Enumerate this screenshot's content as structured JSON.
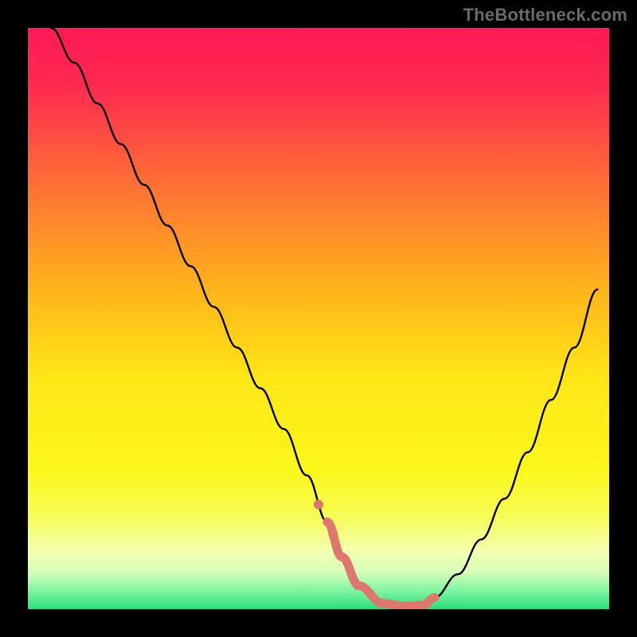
{
  "watermark": "TheBottleneck.com",
  "gradient_stops": [
    {
      "offset": 0.0,
      "color": "#ff1a55"
    },
    {
      "offset": 0.1,
      "color": "#ff2a50"
    },
    {
      "offset": 0.25,
      "color": "#ff6838"
    },
    {
      "offset": 0.45,
      "color": "#ffb41a"
    },
    {
      "offset": 0.6,
      "color": "#ffe617"
    },
    {
      "offset": 0.76,
      "color": "#fbf71a"
    },
    {
      "offset": 0.84,
      "color": "#f6fd55"
    },
    {
      "offset": 0.9,
      "color": "#f4ffb0"
    },
    {
      "offset": 0.935,
      "color": "#d9ffb8"
    },
    {
      "offset": 0.965,
      "color": "#88f7a5"
    },
    {
      "offset": 1.0,
      "color": "#28e07a"
    }
  ],
  "chart_data": {
    "type": "line",
    "title": "",
    "xlabel": "",
    "ylabel": "",
    "xlim": [
      0,
      100
    ],
    "ylim": [
      0,
      100
    ],
    "series": [
      {
        "name": "bottleneck-curve",
        "stroke": "#000000",
        "stroke_width": 2.4,
        "x": [
          4,
          8,
          12,
          16,
          20,
          24,
          28,
          32,
          36,
          40,
          44,
          48,
          51.5,
          54,
          57,
          61,
          65,
          68,
          70,
          74,
          78,
          82,
          86,
          90,
          94,
          98
        ],
        "y": [
          100,
          94,
          87,
          80,
          73,
          66,
          59,
          52,
          45,
          38,
          31,
          23,
          15,
          9,
          4,
          1,
          0.5,
          0.7,
          2,
          6,
          12,
          19,
          27,
          36,
          45,
          55
        ]
      },
      {
        "name": "highlight-segment",
        "stroke": "#de776d",
        "stroke_width": 11,
        "x": [
          51.5,
          54,
          57,
          61,
          65,
          68,
          70
        ],
        "y": [
          15,
          9,
          4,
          1,
          0.5,
          0.7,
          2
        ],
        "dots_x": [
          50,
          52.5
        ],
        "dots_y": [
          18,
          13
        ],
        "dot_radius": 6
      }
    ]
  }
}
